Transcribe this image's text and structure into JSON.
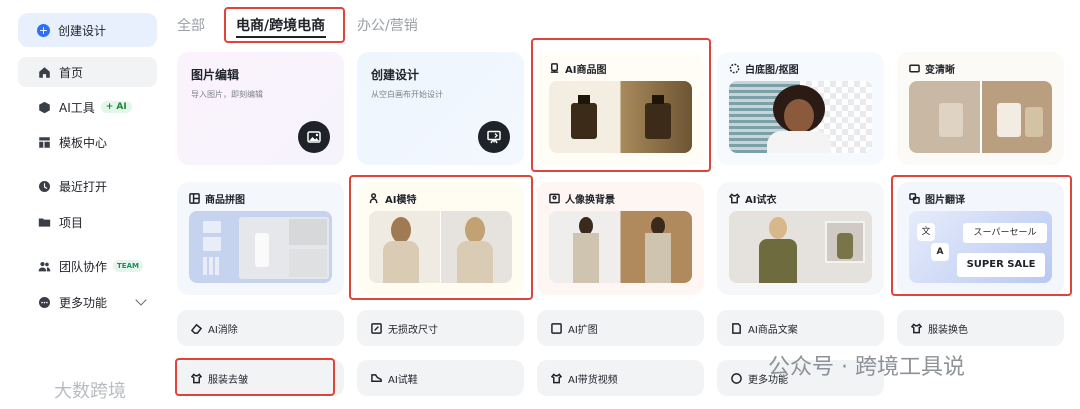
{
  "sidebar": {
    "create": "创建设计",
    "items": [
      {
        "label": "首页"
      },
      {
        "label": "AI工具",
        "badge": "+ AI"
      },
      {
        "label": "模板中心"
      },
      {
        "label": "最近打开"
      },
      {
        "label": "项目"
      },
      {
        "label": "团队协作",
        "badge": "TEAM"
      },
      {
        "label": "更多功能"
      }
    ]
  },
  "tabs": [
    "全部",
    "电商/跨境电商",
    "办公/营销"
  ],
  "active_tab": "电商/跨境电商",
  "top_cards": [
    {
      "title": "图片编辑",
      "subtitle": "导入图片，即刻编辑",
      "icon": "image-icon"
    },
    {
      "title": "创建设计",
      "subtitle": "从空白画布开始设计",
      "icon": "canvas-icon"
    }
  ],
  "feature_cards": [
    {
      "title": "AI商品图",
      "icon": "ai-product-icon"
    },
    {
      "title": "白底图/抠图",
      "icon": "cutout-icon"
    },
    {
      "title": "变清晰",
      "icon": "hd-icon"
    },
    {
      "title": "商品拼图",
      "icon": "collage-icon"
    },
    {
      "title": "AI模特",
      "icon": "model-icon"
    },
    {
      "title": "人像换背景",
      "icon": "background-icon"
    },
    {
      "title": "AI试衣",
      "icon": "tryon-icon"
    },
    {
      "title": "图片翻译",
      "icon": "translate-icon",
      "image_text": {
        "ja": "スーパーセール",
        "en": "SUPER SALE",
        "a": "A",
        "wen": "文"
      }
    }
  ],
  "mini_buttons": [
    [
      "AI消除",
      "无损改尺寸",
      "AI扩图",
      "AI商品文案",
      "服装换色"
    ],
    [
      "服装去皱",
      "AI试鞋",
      "AI带货视频",
      "更多功能"
    ]
  ],
  "watermarks": {
    "left": "大数跨境",
    "right": "公众号 · 跨境工具说"
  },
  "colors": {
    "accent": "#2f6ff5",
    "highlight": "#e0433a"
  }
}
